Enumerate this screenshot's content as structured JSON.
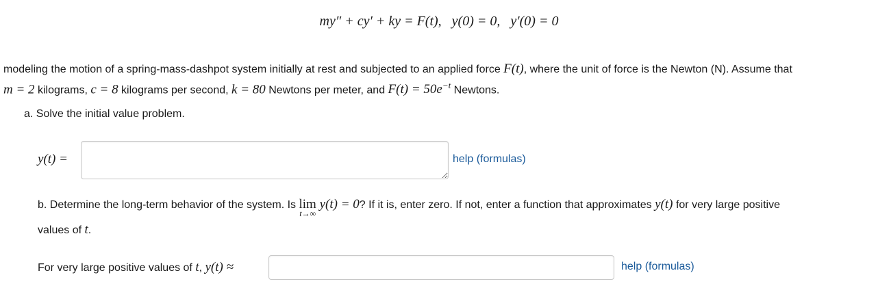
{
  "equation": {
    "lhs": "my″ + cy′ + ky = F(t),",
    "ic1": "y(0) = 0,",
    "ic2": "y′(0) = 0"
  },
  "intro": {
    "line1_text_a": "modeling the motion of a spring-mass-dashpot system initially at rest and subjected to an applied force ",
    "line1_math_F": "F(t)",
    "line1_text_b": ", where the unit of force is the Newton (N). Assume that",
    "line2_math_m": "m = 2",
    "line2_text_m": " kilograms, ",
    "line2_math_c": "c = 8",
    "line2_text_c": " kilograms per second, ",
    "line2_math_k": "k = 80",
    "line2_text_k": " Newtons per meter, and ",
    "line2_math_F": "F(t) = 50e",
    "line2_math_exp": "−t",
    "line2_text_end": " Newtons."
  },
  "part_a": {
    "label": "a. Solve the initial value problem.",
    "y_label": "y(t) =",
    "answer_value": "",
    "help": "help (formulas)"
  },
  "part_b": {
    "text_a": "b. Determine the long-term behavior of the system. Is ",
    "lim": "lim",
    "lim_under": "t→∞",
    "lim_expr": " y(t) = 0",
    "text_b": "? If it is, enter zero. If not, enter a function that approximates ",
    "math_y": "y(t)",
    "text_c": " for very large positive",
    "line2_text": "values of ",
    "line2_math": "t",
    "line2_end": ".",
    "answer_label_a": "For very large positive values of ",
    "answer_label_t": "t",
    "answer_label_comma": ", ",
    "answer_label_math": "y(t) ≈",
    "answer_value": "",
    "help": "help (formulas)"
  },
  "colors": {
    "link": "#1a5a9a",
    "input_border": "#c8c8c8"
  }
}
